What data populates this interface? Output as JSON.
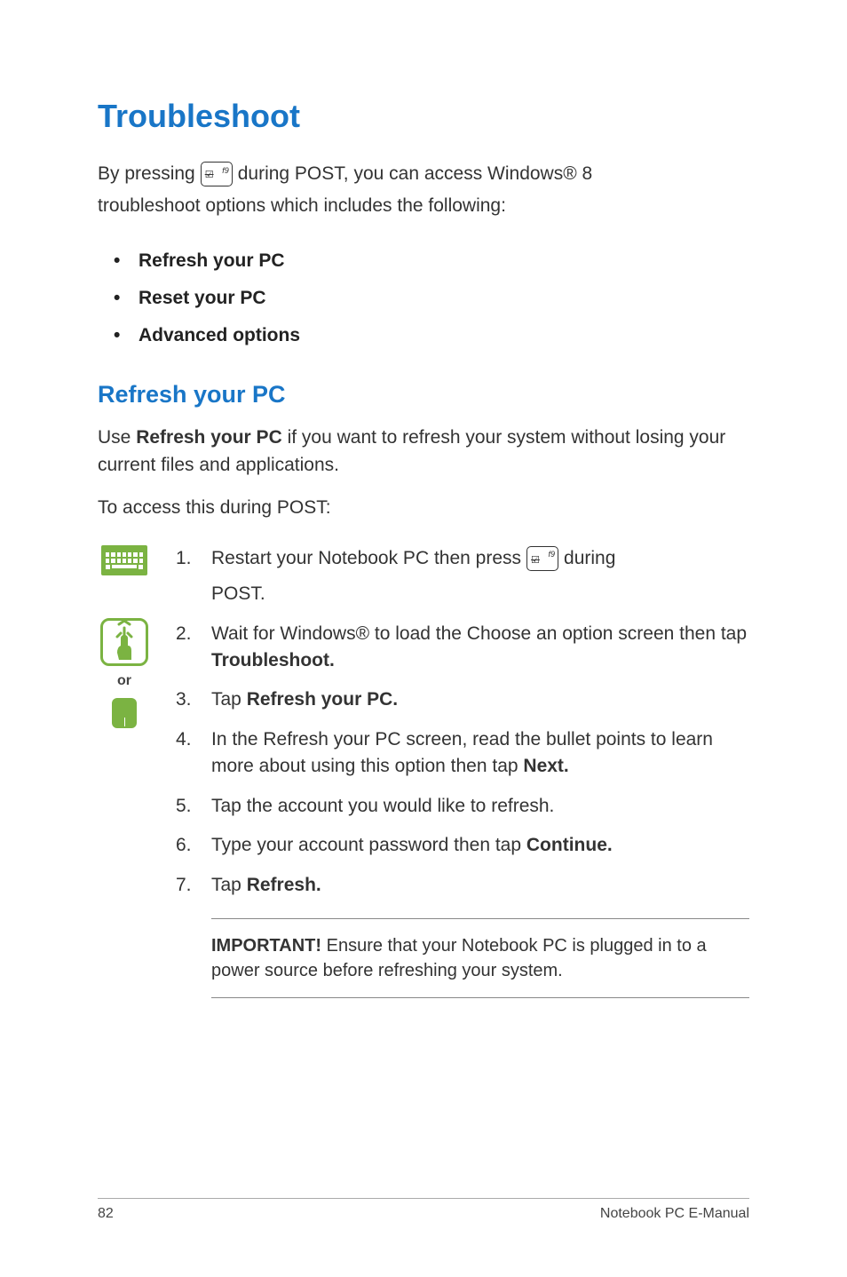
{
  "title": "Troubleshoot",
  "intro": {
    "part1_pre": "By pressing",
    "key_label_z": "☑",
    "key_label_f": "f9",
    "part1_post": "during POST, you can access Windows® 8",
    "line2": "troubleshoot options which includes the following:"
  },
  "bullets": [
    "Refresh your PC",
    "Reset your PC",
    "Advanced options"
  ],
  "section": {
    "heading": "Refresh your PC",
    "para_pre": "Use ",
    "para_bold": "Refresh your PC",
    "para_post": " if you want to refresh your system without losing your current files and applications.",
    "para2": "To access this during POST:"
  },
  "or_label": "or",
  "steps": {
    "s1": {
      "num": "1.",
      "pre": "Restart your Notebook PC then press",
      "post": "during",
      "line2": "POST."
    },
    "s2": {
      "num": "2.",
      "pre": "Wait for Windows® to load the Choose an option screen then tap ",
      "bold": "Troubleshoot."
    },
    "s3": {
      "num": "3.",
      "pre": "Tap ",
      "bold": "Refresh your PC."
    },
    "s4": {
      "num": "4.",
      "pre": "In the Refresh your PC screen, read the bullet points to learn more about using this option then tap ",
      "bold": "Next."
    },
    "s5": {
      "num": "5.",
      "text": "Tap the account you would like to refresh."
    },
    "s6": {
      "num": "6.",
      "pre": "Type your account password then tap ",
      "bold": "Continue."
    },
    "s7": {
      "num": "7.",
      "pre": "Tap ",
      "bold": "Refresh."
    }
  },
  "important": {
    "bold": "IMPORTANT!",
    "text": " Ensure that your Notebook PC is plugged in to a power source before refreshing your system."
  },
  "footer": {
    "page": "82",
    "label": "Notebook PC E-Manual"
  }
}
